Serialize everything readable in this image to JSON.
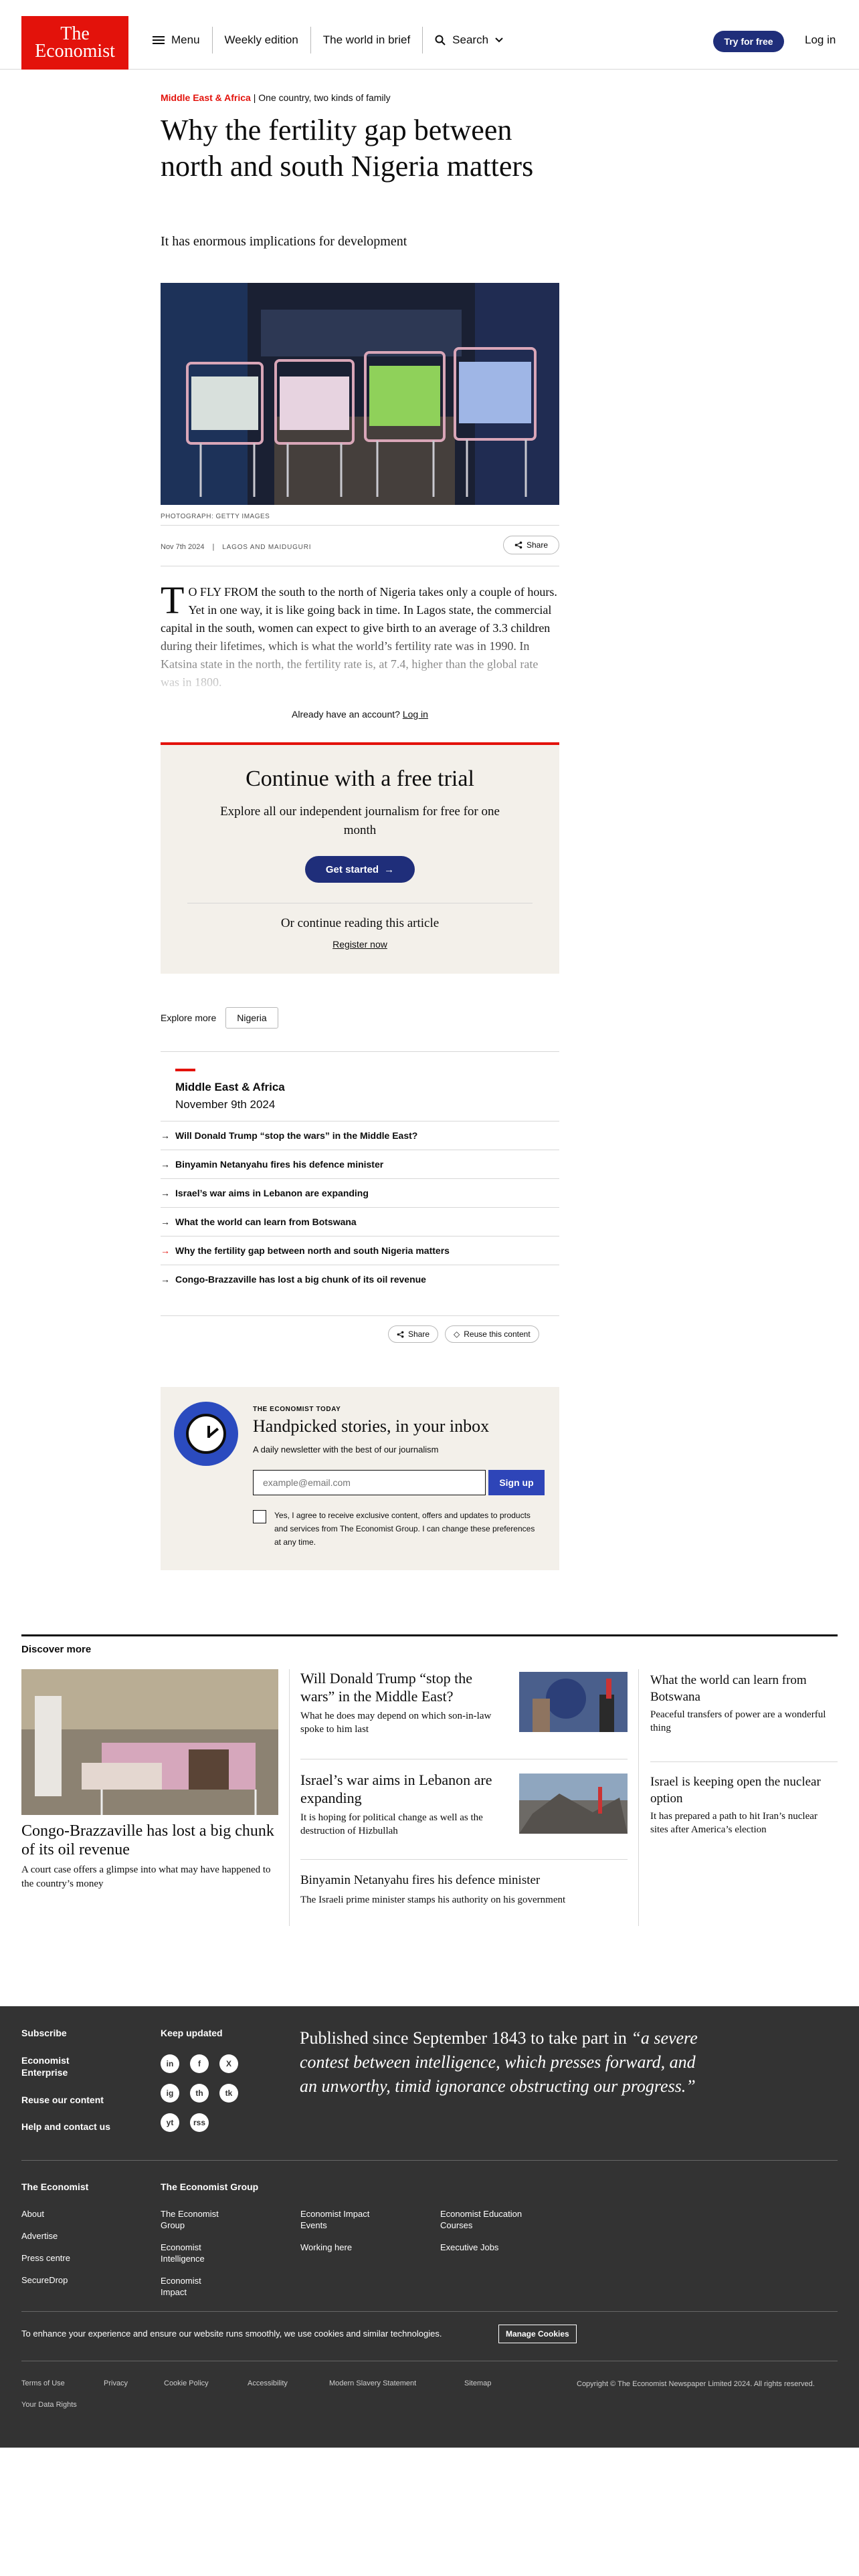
{
  "header": {
    "logo_line1": "The",
    "logo_line2": "Economist",
    "nav": [
      "Menu",
      "Weekly edition",
      "The world in brief",
      "Search"
    ],
    "try_label": "Try for free",
    "login_label": "Log in"
  },
  "article": {
    "section": "Middle East & Africa",
    "fly_title": "One country, two kinds of family",
    "headline": "Why the fertility gap between north and south Nigeria matters",
    "standfirst": "It has enormous implications for development",
    "photo_credit": "PHOTOGRAPH: GETTY IMAGES",
    "date": "Nov 7th 2024",
    "dateline": "LAGOS AND MAIDUGURI",
    "share_label": "Share",
    "dropcap": "T",
    "lead_caps": "O FLY FROM",
    "body": " the south to the north of Nigeria takes only a couple of hours. Yet in one way, it is like going back in time. In Lagos state, the commercial capital in the south, women can expect to give birth to an average of 3.3 children during their lifetimes, which is what the world’s fertility rate was in 1990. In Katsina state in the north, the fertility rate is, at 7.4, higher than the global rate was in 1800.",
    "already_text": "Already have an account?",
    "login_link": "Log in"
  },
  "trial": {
    "title": "Continue with a free trial",
    "subtitle": "Explore all our independent journalism for free for one month",
    "button": "Get started",
    "or_continue": "Or continue reading this article",
    "register": "Register now"
  },
  "explore": {
    "label": "Explore more",
    "tag": "Nigeria"
  },
  "related": {
    "section": "Middle East & Africa",
    "date": "November 9th 2024",
    "items": [
      "Will Donald Trump “stop the wars” in the Middle East?",
      "Binyamin Netanyahu fires his defence minister",
      "Israel’s war aims in Lebanon are expanding",
      "What the world can learn from Botswana",
      "Why the fertility gap between north and south Nigeria matters",
      "Congo-Brazzaville has lost a big chunk of its oil revenue"
    ],
    "share": "Share",
    "reuse": "Reuse this content"
  },
  "newsletter": {
    "kicker": "THE ECONOMIST TODAY",
    "title": "Handpicked stories, in your inbox",
    "desc": "A daily newsletter with the best of our journalism",
    "placeholder": "example@email.com",
    "signup": "Sign up",
    "consent": "Yes, I agree to receive exclusive content, offers and updates to products and services from The Economist Group. I can change these preferences at any time."
  },
  "discover": {
    "title": "Discover more",
    "lead": {
      "headline": "Congo-Brazzaville has lost a big chunk of its oil revenue",
      "desc": "A court case offers a glimpse into what may have happened to the country’s money"
    },
    "mid": [
      {
        "headline": "Will Donald Trump “stop the wars” in the Middle East?",
        "desc": "What he does may depend on which son-in-law spoke to him last"
      },
      {
        "headline": "Israel’s war aims in Lebanon are expanding",
        "desc": "It is hoping for political change as well as the destruction of Hizbullah"
      },
      {
        "headline": "Binyamin Netanyahu fires his defence minister",
        "desc": "The Israeli prime minister stamps his authority on his government"
      }
    ],
    "right": [
      {
        "headline": "What the world can learn from Botswana",
        "desc": "Peaceful transfers of power are a wonderful thing"
      },
      {
        "headline": "Israel is keeping open the nuclear option",
        "desc": "It has prepared a path to hit Iran’s nuclear sites after America’s election"
      }
    ]
  },
  "footer": {
    "links_left": [
      "Subscribe",
      "Economist Enterprise",
      "Reuse our content",
      "Help and contact us"
    ],
    "keep_updated": "Keep updated",
    "social": [
      "in",
      "f",
      "X",
      "ig",
      "th",
      "tk",
      "yt",
      "rss"
    ],
    "quote_plain": "Published since September 1843 to take part in ",
    "quote_italic": "“a severe contest between intelligence, which presses forward, and an unworthy, timid ignorance obstructing our progress.”",
    "col1_title": "The Economist",
    "col1": [
      "About",
      "Advertise",
      "Press centre",
      "SecureDrop"
    ],
    "col2_title": "The Economist Group",
    "col2": [
      "The Economist Group",
      "Economist Intelligence",
      "Economist Impact"
    ],
    "col3": [
      "Economist Impact Events",
      "Working here"
    ],
    "col4": [
      "Economist Education Courses",
      "Executive Jobs"
    ],
    "cookie_text": "To enhance your experience and ensure our website runs smoothly, we use cookies and similar technologies.",
    "cookie_button": "Manage Cookies",
    "legal": [
      "Terms of Use",
      "Privacy",
      "Cookie Policy",
      "Accessibility",
      "Modern Slavery Statement",
      "Sitemap",
      "Your Data Rights"
    ],
    "copyright": "Copyright © The Economist Newspaper Limited 2024. All rights reserved."
  },
  "colors": {
    "brand_red": "#e3120b",
    "navy": "#1f2e7a",
    "cream": "#f3f0ea",
    "footer_bg": "#333333"
  }
}
